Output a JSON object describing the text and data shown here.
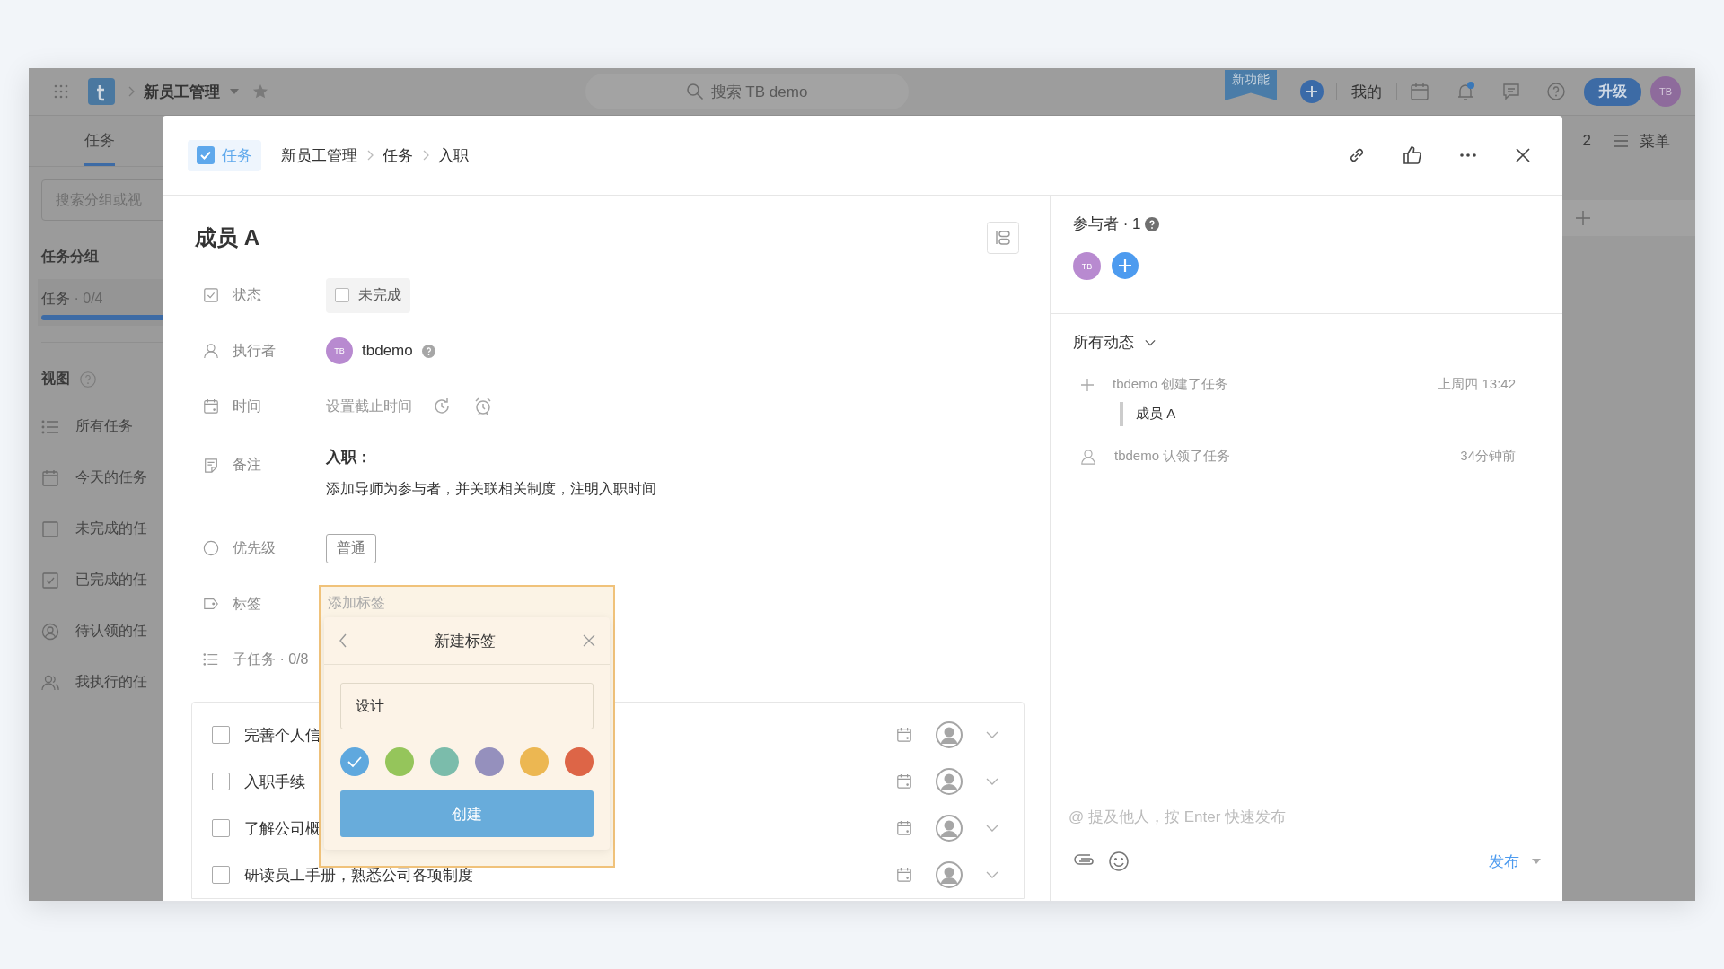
{
  "topbar": {
    "project": "新员工管理",
    "search_placeholder": "搜索 TB demo",
    "new_feature": "新功能",
    "mine": "我的",
    "has_unread": true,
    "upgrade": "升级",
    "avatar": "TB"
  },
  "tabs": [
    {
      "label": "任务",
      "selected": true
    }
  ],
  "sidebar": {
    "search_placeholder": "搜索分组或视",
    "groups_title": "任务分组",
    "groups": [
      {
        "label": "任务",
        "count": "· 0/4",
        "selected": true
      }
    ],
    "views_title": "视图",
    "views": [
      {
        "kind": "list",
        "label": "所有任务"
      },
      {
        "kind": "calendar",
        "label": "今天的任务"
      },
      {
        "kind": "box",
        "label": "未完成的任"
      },
      {
        "kind": "checked",
        "label": "已完成的任"
      },
      {
        "kind": "user-circle",
        "label": "待认领的任"
      },
      {
        "kind": "users",
        "label": "我执行的任"
      }
    ]
  },
  "right_strip": {
    "count": "2",
    "menu": "菜单"
  },
  "modal": {
    "type_chip": "任务",
    "breadcrumb": [
      "新员工管理",
      "任务",
      "入职"
    ],
    "title": "成员 A",
    "fields": [
      {
        "kind": "status",
        "label": "状态",
        "value": "未完成",
        "checked": false
      },
      {
        "kind": "assignee",
        "label": "执行者",
        "avatar": "TB",
        "value": "tbdemo"
      },
      {
        "kind": "time",
        "label": "时间",
        "placeholder": "设置截止时间"
      },
      {
        "kind": "note",
        "label": "备注",
        "heading": "入职：",
        "value": "添加导师为参与者，并关联相关制度，注明入职时间"
      },
      {
        "kind": "priority",
        "label": "优先级",
        "value": "普通"
      },
      {
        "kind": "tags",
        "label": "标签",
        "placeholder": "添加标签"
      },
      {
        "kind": "subtasks",
        "label": "子任务 · 0/8"
      }
    ],
    "subtasks": [
      {
        "title": "完善个人信",
        "done": false
      },
      {
        "title": "入职手续",
        "done": false
      },
      {
        "title": "了解公司概",
        "done": false
      },
      {
        "title": "研读员工手册，熟悉公司各项制度",
        "done": false
      }
    ],
    "tag_popup": {
      "title": "新建标签",
      "name": "设计",
      "create": "创建",
      "colors": [
        {
          "color": "#5fa8de",
          "selected": true
        },
        {
          "color": "#95c55b",
          "selected": false
        },
        {
          "color": "#7bbcab",
          "selected": false
        },
        {
          "color": "#9590bd",
          "selected": false
        },
        {
          "color": "#ecb752",
          "selected": false
        },
        {
          "color": "#dd6547",
          "selected": false
        }
      ]
    },
    "participants": {
      "title": "参与者 · 1",
      "avatars": [
        "TB"
      ]
    },
    "activity": {
      "filter": "所有动态",
      "items": [
        {
          "kind": "create",
          "text": "tbdemo 创建了任务",
          "time": "上周四 13:42",
          "quote": "成员 A"
        },
        {
          "kind": "claim",
          "text": "tbdemo 认领了任务",
          "time": "34分钟前"
        }
      ]
    },
    "composer": {
      "placeholder": "@ 提及他人，按 Enter 快速发布",
      "publish": "发布"
    }
  }
}
